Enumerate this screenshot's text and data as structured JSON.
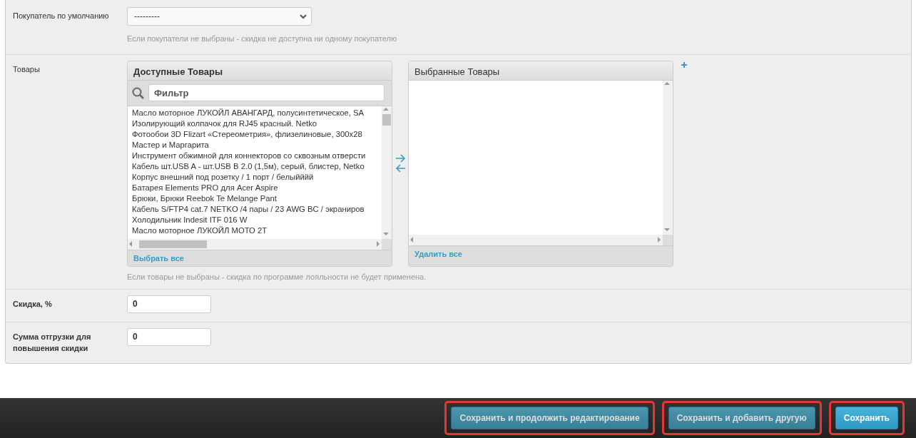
{
  "fields": [
    {
      "kind": "select",
      "label": "Покупатель по умолчанию",
      "value": "---------",
      "help": "Если покупатели не выбраны - скидка не доступна ни одному покупателю"
    },
    {
      "kind": "selector",
      "label": "Товары",
      "available": {
        "title": "Доступные Товары",
        "filter_placeholder": "Фильтр",
        "items": [
          "Масло моторное ЛУКОЙЛ АВАНГАРД, полусинтетическое, SA",
          "Изолирующий колпачок для RJ45 красный. Netko",
          "Фотообои 3D Flizart «Стереометрия», флизелиновые, 300x28",
          "Мастер и Маргарита",
          "Инструмент обжимной для коннекторов со сквозным отверсти",
          "Кабель шт.USB A - шт.USB B 2.0 (1,5м), серый, блистер, Netko",
          "Корпус внешний под розетку / 1 порт / белыйййй",
          "Батарея Elements PRO для Acer Aspire",
          "Брюки, Брюки Reebok Te Melange Pant",
          "Кабель S/FTP4 cat.7 NETKO /4 пары / 23 AWG BC / экраниров",
          "Холодильник Indesit ITF 016 W",
          "Масло моторное ЛУКОЙЛ МОТО 2Т"
        ],
        "action": "Выбрать все"
      },
      "chosen": {
        "title": "Выбранные Товары",
        "action": "Удалить все"
      },
      "help": "Если товары не выбраны - скидка по программе лояльности не будет применена."
    },
    {
      "kind": "input",
      "label": "Скидка, %",
      "value": "0"
    },
    {
      "kind": "input",
      "label": "Сумма отгрузки для повышения скидки",
      "value": "0"
    }
  ],
  "buttons": [
    {
      "label": "Сохранить и продолжить редактирование",
      "primary": false,
      "highlighted": true
    },
    {
      "label": "Сохранить и добавить другую",
      "primary": false,
      "highlighted": true
    },
    {
      "label": "Сохранить",
      "primary": true,
      "highlighted": true
    }
  ]
}
